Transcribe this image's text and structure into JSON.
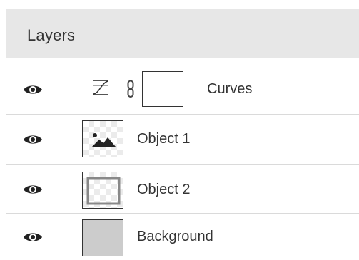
{
  "panel": {
    "title": "Layers"
  },
  "layers": [
    {
      "name": "Curves",
      "type": "adjustment",
      "visible": true,
      "icon": "curves-icon",
      "linked": true
    },
    {
      "name": "Object 1",
      "type": "image",
      "visible": true
    },
    {
      "name": "Object 2",
      "type": "image",
      "visible": true
    },
    {
      "name": "Background",
      "type": "fill",
      "visible": true,
      "fill_color": "#cccccc"
    }
  ],
  "colors": {
    "header_bg": "#e7e7e7",
    "text": "#333333",
    "divider": "#dadada"
  }
}
